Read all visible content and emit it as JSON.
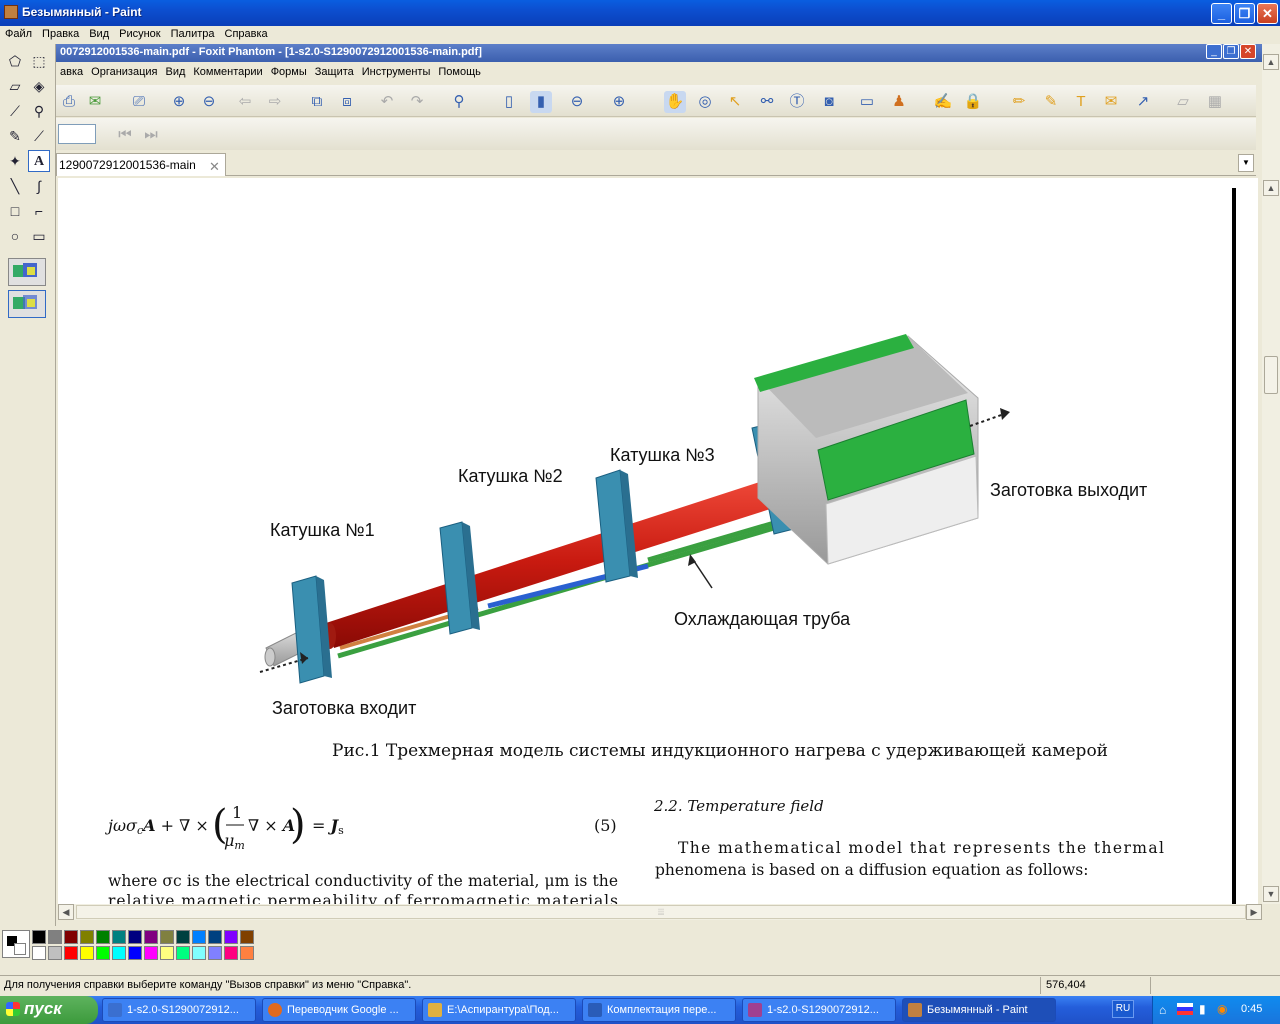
{
  "paint": {
    "title": "Безымянный - Paint",
    "menu": [
      "Файл",
      "Правка",
      "Вид",
      "Рисунок",
      "Палитра",
      "Справка"
    ],
    "status_help": "Для получения справки выберите команду \"Вызов справки\" из меню \"Справка\".",
    "coords": "576,404"
  },
  "foxit": {
    "title": "0072912001536-main.pdf - Foxit Phantom - [1-s2.0-S1290072912001536-main.pdf]",
    "menu": [
      "авка",
      "Организация",
      "Вид",
      "Комментарии",
      "Формы",
      "Защита",
      "Инструменты",
      "Помощь"
    ],
    "tab_label": "1290072912001536-main",
    "tab_close": "✕"
  },
  "document": {
    "labels": {
      "coil1": "Катушка №1",
      "coil2": "Катушка №2",
      "coil3": "Катушка №3",
      "exit": "Заготовка выходит",
      "cooling": "Охлаждающая труба",
      "enter": "Заготовка входит"
    },
    "caption": "Рис.1 Трехмерная модель системы индукционного нагрева с удерживающей камерой",
    "eq_number": "(5)",
    "where_line1": "where σc is the electrical conductivity of the material, μm is the",
    "where_line2": "relative magnetic permeability of ferromagnetic materials",
    "section_heading": "2.2.  Temperature field",
    "para_line1": "The mathematical model that represents the thermal",
    "para_line2": "phenomena is based on a diffusion equation as follows:"
  },
  "palette_colors": [
    "#000000",
    "#808080",
    "#800000",
    "#808000",
    "#008000",
    "#008080",
    "#000080",
    "#800080",
    "#808040",
    "#004040",
    "#0080ff",
    "#004080",
    "#8000ff",
    "#804000",
    "#ffffff",
    "#c0c0c0",
    "#ff0000",
    "#ffff00",
    "#00ff00",
    "#00ffff",
    "#0000ff",
    "#ff00ff",
    "#ffff80",
    "#00ff80",
    "#80ffff",
    "#8080ff",
    "#ff0080",
    "#ff8040"
  ],
  "taskbar": {
    "start": "пуск",
    "items": [
      {
        "label": "1-s2.0-S1290072912...",
        "color": "#3a6fd0"
      },
      {
        "label": "Переводчик Google ...",
        "color": "#e06a20"
      },
      {
        "label": "E:\\Аспирантура\\Под...",
        "color": "#e0b040"
      },
      {
        "label": "Комплектация пере...",
        "color": "#2a5cb8"
      },
      {
        "label": "1-s2.0-S1290072912...",
        "color": "#a04090"
      },
      {
        "label": "Безымянный - Paint",
        "color": "#c08040"
      }
    ],
    "lang": "RU",
    "clock": "0:45"
  }
}
